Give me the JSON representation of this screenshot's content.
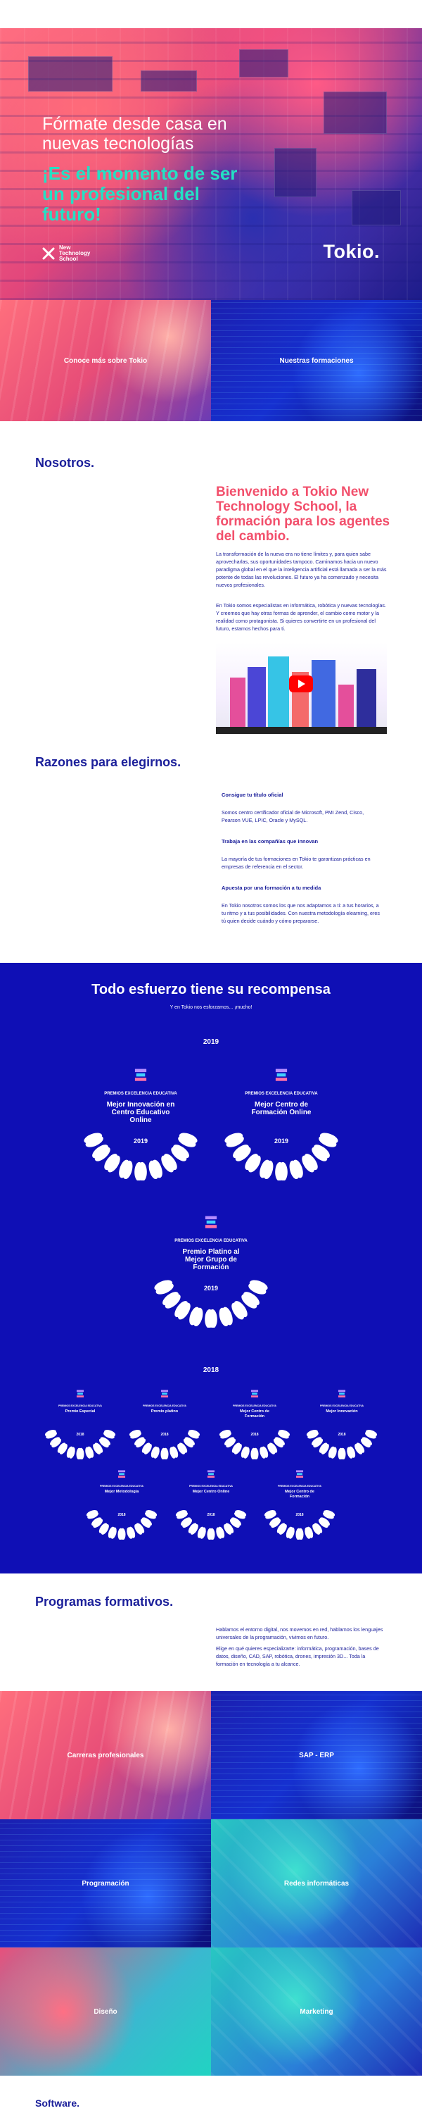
{
  "hero": {
    "title": "Fórmate desde casa en nuevas tecnologías",
    "subtitle": "¡Es el momento de ser un profesional del futuro!",
    "nts_logo_text": "New Technology School",
    "tokio_logo": "Tokio."
  },
  "tiles_top": [
    {
      "label": "Conoce más sobre Tokio"
    },
    {
      "label": "Nuestras formaciones"
    }
  ],
  "nosotros": {
    "title": "Nosotros.",
    "welcome": "Bienvenido a Tokio New Technology School, la formación para los agentes del cambio.",
    "p1": "La transformación de la nueva era no tiene límites y, para quien sabe aprovecharlas, sus oportunidades tampoco. Caminamos hacia un nuevo paradigma global en el que la inteligencia artificial está llamada a ser la más potente de todas las revoluciones. El futuro ya ha comenzado y necesita nuevos profesionales.",
    "p2": "En Tokio somos especialistas en informática, robótica y nuevas tecnologías. Y creemos que hay otras formas de aprender, el cambio como motor y la realidad como protagonista. Si quieres convertirte en un profesional del futuro, estamos hechos para ti."
  },
  "razones": {
    "title": "Razones para elegirnos.",
    "items": [
      {
        "head": "Consigue tu título oficial",
        "text": "Somos centro certificador oficial de Microsoft, PMI Zend, Cisco, Pearson VUE, LPIC, Oracle y MySQL."
      },
      {
        "head": "Trabaja en las compañías que innovan",
        "text": "La mayoría de tus formaciones en Tokio te garantizan prácticas en empresas de referencia en el sector."
      },
      {
        "head": "Apuesta por una formación a tu medida",
        "text": "En Tokio nosotros somos los que nos adaptamos a ti: a tus horarios, a tu ritmo y a tus posibilidades. Con nuestra metodología elearning, eres tú quien decide cuándo y cómo prepararse."
      }
    ]
  },
  "awards": {
    "title": "Todo esfuerzo tiene su recompensa",
    "subtitle": "Y en Tokio nos esforzamos... ¡mucho!",
    "year_2019": "2019",
    "year_2018": "2018",
    "header_text": "PREMIOS EXCELENCIA EDUCATIVA",
    "items_2019": [
      {
        "name": "Mejor Innovación en Centro Educativo Online",
        "year": "2019"
      },
      {
        "name": "Mejor Centro de Formación Online",
        "year": "2019"
      },
      {
        "name": "Premio Platino al Mejor Grupo de Formación",
        "year": "2019"
      }
    ],
    "items_2018": [
      {
        "name": "Premio Especial",
        "year": "2018"
      },
      {
        "name": "Premio platino",
        "year": "2018"
      },
      {
        "name": "Mejor Centro de Formación",
        "year": "2018"
      },
      {
        "name": "Mejor Innovación",
        "year": "2018"
      },
      {
        "name": "Mejor Metodología",
        "year": "2018"
      },
      {
        "name": "Mejor Centro Online",
        "year": "2018"
      },
      {
        "name": "Mejor Centro de Formación",
        "year": "2018"
      }
    ]
  },
  "programas": {
    "title": "Programas formativos.",
    "p1": "Hablamos el entorno digital, nos movemos en red, hablamos los lenguajes universales de la programación, vivimos en futuro.",
    "p2": "Elige en qué quieres especializarte: informática, programación, bases de datos, diseño, CAD, SAP, robótica, drones, impresión 3D... Toda la formación en tecnología a tu alcance.",
    "tiles": [
      {
        "label": "Carreras profesionales"
      },
      {
        "label": "SAP - ERP"
      },
      {
        "label": "Programación"
      },
      {
        "label": "Redes informáticas"
      },
      {
        "label": "Diseño"
      },
      {
        "label": "Marketing"
      }
    ],
    "bottom_title": "Software."
  }
}
